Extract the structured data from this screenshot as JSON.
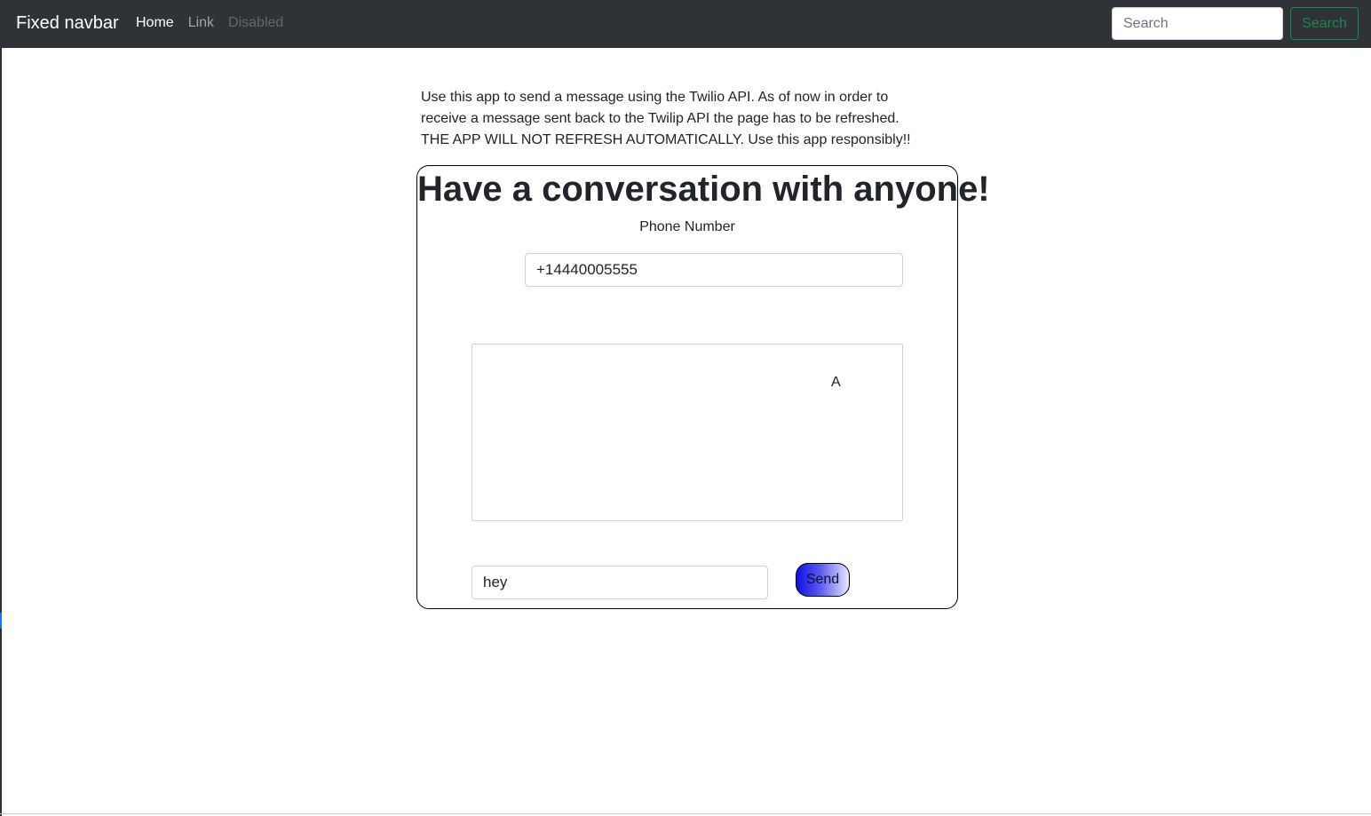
{
  "navbar": {
    "brand": "Fixed navbar",
    "links": [
      {
        "label": "Home",
        "state": "active"
      },
      {
        "label": "Link",
        "state": "normal"
      },
      {
        "label": "Disabled",
        "state": "disabled"
      }
    ],
    "search_placeholder": "Search",
    "search_button_label": "Search"
  },
  "intro_text": "Use this app to send a message using the Twilio API. As of now in order to receive a message sent back to the Twilip API the page has to be refreshed. THE APP WILL NOT REFRESH AUTOMATICALLY. Use this app responsibly!!",
  "card": {
    "title": "Have a conversation with anyone!",
    "phone_label": "Phone Number",
    "phone_value": "+14440005555",
    "messages": [
      "A"
    ],
    "message_value": "hey",
    "send_label": "Send"
  },
  "colors": {
    "navbar_bg": "#2f3237",
    "success": "#198754",
    "send_gradient_start": "#1010e6",
    "send_gradient_end": "#e6e6ff"
  }
}
